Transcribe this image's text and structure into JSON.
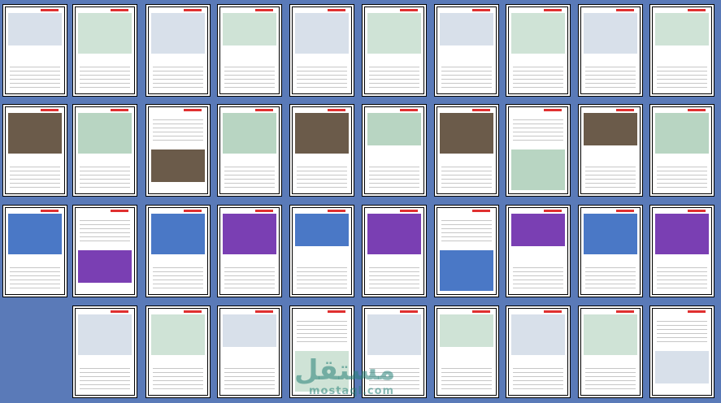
{
  "grid": {
    "rows": 4,
    "columns": 10
  },
  "watermark": {
    "text_arabic": "مستقل",
    "text_latin": "mostaql.com"
  }
}
